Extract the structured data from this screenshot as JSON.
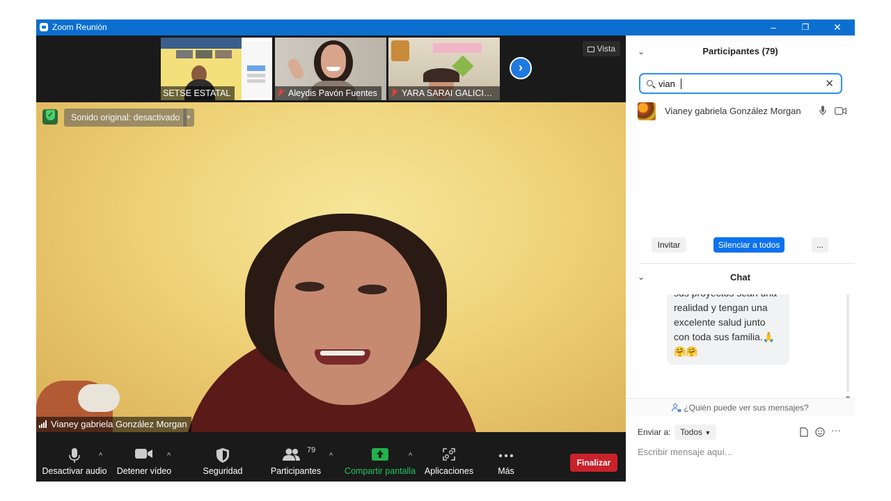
{
  "window": {
    "title": "Zoom Reunión",
    "controls": {
      "minimize": "–",
      "restore": "❐",
      "close": "✕"
    }
  },
  "thumbnails": [
    {
      "name": "SETSE ESTATAL",
      "muted": false
    },
    {
      "name": "Aleydis Pavón Fuentes",
      "muted": true
    },
    {
      "name": "YARA SARAI GALICIA ...",
      "muted": true
    }
  ],
  "view_button": "Vista",
  "main_video": {
    "sound_label": "Sonido original: desactivado",
    "speaker_name": "Vianey gabriela González Morgan"
  },
  "toolbar": {
    "mute_label": "Desactivar audio",
    "video_label": "Detener vídeo",
    "security_label": "Seguridad",
    "participants_label": "Participantes",
    "participants_count": "79",
    "share_label": "Compartir pantalla",
    "apps_label": "Aplicaciones",
    "more_label": "Más",
    "end_label": "Finalizar"
  },
  "participants_panel": {
    "title": "Participantes (79)",
    "search_value": "vian",
    "results": [
      {
        "name": "Vianey gabriela González Morgan"
      }
    ],
    "invite_label": "Invitar",
    "mute_all_label": "Silenciar a todos",
    "more_label": "..."
  },
  "chat_panel": {
    "title": "Chat",
    "message": "sus proyectos sean una realidad y tengan una excelente salud junto con toda sus familia.🙏 🤗🤗",
    "visibility_label": "¿Quién puede ver sus mensajes?",
    "send_to_label": "Enviar a:",
    "send_to_value": "Todos",
    "input_placeholder": "Escribir mensaje aquí..."
  },
  "colors": {
    "titlebar": "#0b6fd0",
    "accent_blue": "#2d8cff",
    "end_red": "#c9222b",
    "share_green": "#22b14c"
  }
}
